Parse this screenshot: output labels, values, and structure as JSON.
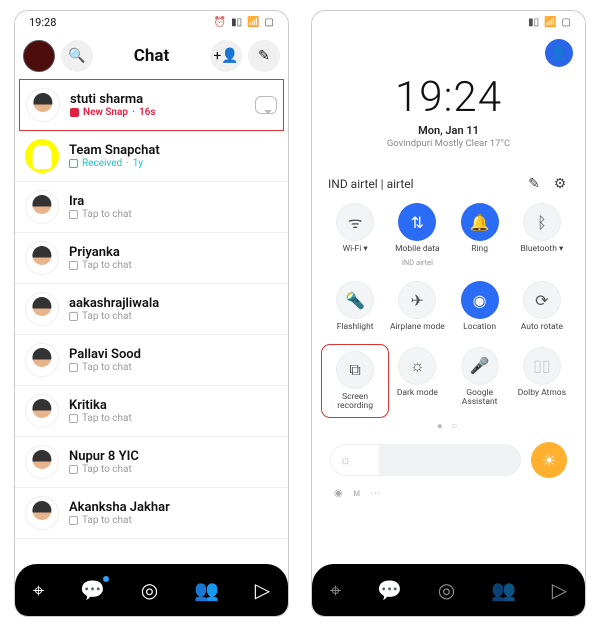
{
  "left": {
    "status_time": "19:28",
    "header": {
      "title": "Chat"
    },
    "chats": [
      {
        "name": "stuti sharma",
        "status": "New Snap",
        "time": "16s",
        "kind": "red",
        "highlighted": true,
        "avatar": "bitmoji"
      },
      {
        "name": "Team Snapchat",
        "status": "Received",
        "time": "1y",
        "kind": "teal",
        "avatar": "ghost"
      },
      {
        "name": "Ira",
        "status": "Tap to chat",
        "time": "",
        "kind": "idle",
        "avatar": "bitmoji"
      },
      {
        "name": "Priyanka",
        "status": "Tap to chat",
        "time": "",
        "kind": "idle",
        "avatar": "bitmoji"
      },
      {
        "name": "aakashrajliwala",
        "status": "Tap to chat",
        "time": "",
        "kind": "idle",
        "avatar": "bitmoji"
      },
      {
        "name": "Pallavi Sood",
        "status": "Tap to chat",
        "time": "",
        "kind": "idle",
        "avatar": "bitmoji"
      },
      {
        "name": "Kritika",
        "status": "Tap to chat",
        "time": "",
        "kind": "idle",
        "avatar": "bitmoji"
      },
      {
        "name": "Nupur 8 YIC",
        "status": "Tap to chat",
        "time": "",
        "kind": "idle",
        "avatar": "bitmoji"
      },
      {
        "name": "Akanksha Jakhar",
        "status": "Tap to chat",
        "time": "",
        "kind": "idle",
        "avatar": "bitmoji"
      }
    ]
  },
  "right": {
    "big_time": "19:24",
    "date": "Mon, Jan 11",
    "weather": "Govindpuri Mostly Clear 17°C",
    "carrier": "IND airtel | airtel",
    "tiles": [
      {
        "label": "Wi-Fi ▾",
        "icon": "wifi",
        "active": false
      },
      {
        "label": "Mobile data",
        "sub": "IND airtel",
        "icon": "data",
        "active": true
      },
      {
        "label": "Ring",
        "icon": "bell",
        "active": true
      },
      {
        "label": "Bluetooth ▾",
        "icon": "bt",
        "active": false
      },
      {
        "label": "Flashlight",
        "icon": "torch",
        "active": false
      },
      {
        "label": "Airplane mode",
        "icon": "plane",
        "active": false
      },
      {
        "label": "Location",
        "icon": "loc",
        "active": true
      },
      {
        "label": "Auto rotate",
        "icon": "rotate",
        "active": false
      },
      {
        "label": "Screen recording",
        "icon": "rec",
        "active": false,
        "highlighted": true
      },
      {
        "label": "Dark mode",
        "icon": "dark",
        "active": false
      },
      {
        "label": "Google Assistant",
        "icon": "mic",
        "active": false
      },
      {
        "label": "Dolby Atmos",
        "icon": "dolby",
        "active": false,
        "disabled": true
      }
    ],
    "page_dots": "● ○"
  }
}
